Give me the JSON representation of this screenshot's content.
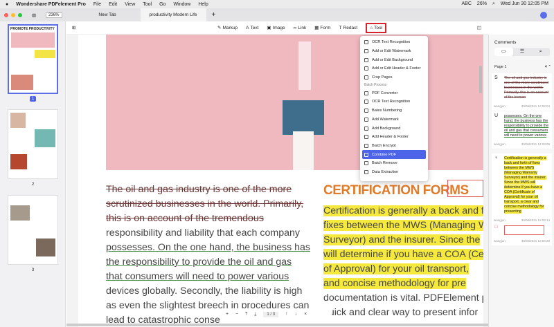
{
  "menubar": {
    "app": "Wondershare PDFelement Pro",
    "items": [
      "File",
      "Edit",
      "View",
      "Tool",
      "Go",
      "Window",
      "Help"
    ],
    "status": {
      "input": "ABC",
      "battery": "26%",
      "datetime": "Wed Jun 30  12:05 PM"
    }
  },
  "tabbar": {
    "zoom": "236%",
    "tabs": [
      "New Tab",
      "productivity Modern Life"
    ],
    "new_tab": "+"
  },
  "toolbar": {
    "items": [
      "Markup",
      "Text",
      "Image",
      "Link",
      "Form",
      "Redact",
      "Tool"
    ]
  },
  "thumbnails": {
    "pages": [
      "1",
      "2",
      "3"
    ],
    "title1": "PROMOTE PRODUCTIVITY"
  },
  "tool_menu": {
    "items": [
      "OCR Text Recognition",
      "Add or Edit Watermark",
      "Add or Edit Background",
      "Add or Edit Header & Footer",
      "Crop Pages"
    ],
    "section": "Batch Process",
    "batch_items": [
      "PDF Converter",
      "OCR Text Recognition",
      "Bates Numbering",
      "Add Watermark",
      "Add Background",
      "Add Header & Footer",
      "Batch Encrypt",
      "Combine PDF",
      "Batch Remove",
      "Data Extraction"
    ],
    "highlight_color": "#4d63e8"
  },
  "document": {
    "left_lines": [
      "The oil and gas industry is one of the more",
      "scrutinized businesses in the world. Primarily,",
      "this is on account of the tremendous",
      "responsibility and liability that each company",
      "possesses. On the one hand, the business has",
      "the responsibility to provide the oil and gas",
      "that consumers will need to power various",
      "devices globally. Secondly, the liability is high",
      "as even the slightest breech in procedures can",
      "lead to catastrophic conse"
    ],
    "cert_title": "CERTIFICATION FORMS",
    "right_lines": [
      "Certification is generally a back and f",
      "fixes between the MWS (Managing W",
      "Surveyor) and the insurer. Since the",
      "will determine if you have a COA (Cer",
      "of Approval) for your oil transport,",
      "and concise methodology for pre",
      "documentation is vital. PDFElement p",
      "quick and clear way to present infor"
    ]
  },
  "bottombar": {
    "page": "1 / 3",
    "zoom_in": "+",
    "zoom_out": "−",
    "close": "×"
  },
  "comments": {
    "title": "Comments",
    "page_label": "Page 1",
    "count": "4",
    "cards": [
      {
        "icon": "S",
        "text": "The oil and gas industry is one of the more scrutinized businesses in the world. Primarily, this is on account of the tremon",
        "author": "wangjun",
        "time": "30/06/2021 12:03:04",
        "style": "strike"
      },
      {
        "icon": "U",
        "text": "possesses. On the one hand, the business has the responsibility to provide the oil and gas that consumers will need to power various",
        "author": "wangjun",
        "time": "30/06/2021 12:03:08",
        "style": "under"
      },
      {
        "icon": "♀",
        "text": "Certification is generally a back and forth of fixes between the MWS (Managing Warranty Surveyor) and the insurer. Since the MWS will determine if you have a COA (Certificate of Approval) for your oil transport, a clear and concise methodology for presenting",
        "author": "wangjun",
        "time": "30/06/2021 12:03:14",
        "style": "hl"
      },
      {
        "icon": "□",
        "text": "",
        "author": "wangjun",
        "time": "30/06/2021 12:03:20",
        "style": "box"
      }
    ]
  }
}
